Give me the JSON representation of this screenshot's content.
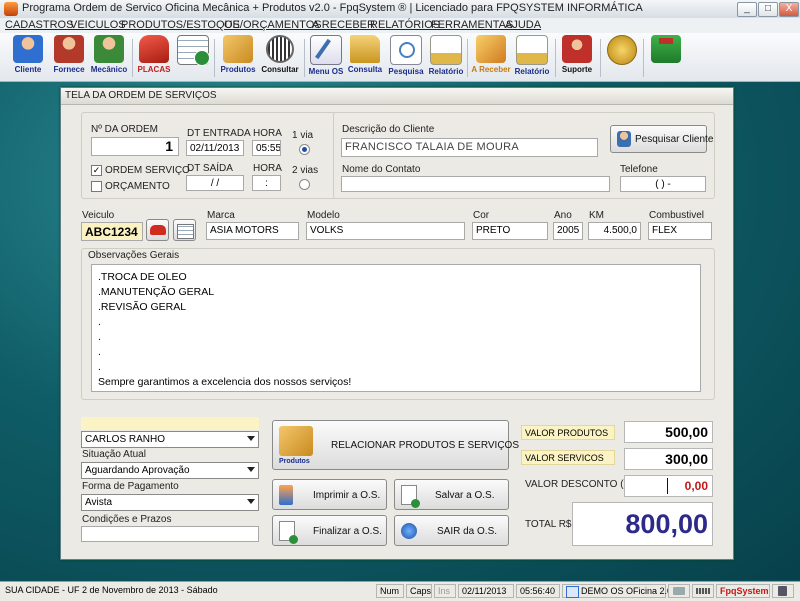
{
  "window": {
    "title": "Programa Ordem de Servico Oficina Mecânica + Produtos v2.0 - FpqSystem ® | Licenciado para FPQSYSTEM INFORMÁTICA",
    "buttons": [
      "_",
      "□",
      "X"
    ]
  },
  "menu": [
    "CADASTROS",
    "VEICULOS",
    "PRODUTOS/ESTOQUE",
    "OS/ORÇAMENTOS",
    "A RECEBER",
    "RELATÓRIOS",
    "FERRAMENTAS",
    "AJUDA"
  ],
  "toolbar": [
    {
      "label": "Cliente",
      "icon": "user-icon",
      "color": "#2f6fcf"
    },
    {
      "label": "Fornece",
      "icon": "supplier-icon",
      "color": "#b33a2b"
    },
    {
      "label": "Mecânico",
      "icon": "mechanic-icon",
      "color": "#3a8a3a"
    },
    {
      "label": "PLACAS",
      "icon": "car-icon",
      "color": "#d12b1e"
    },
    {
      "label": "",
      "icon": "calendar-clock-icon",
      "color": "#2b8f3a"
    },
    {
      "label": "Produtos",
      "icon": "boxes-icon",
      "color": "#d99a2b"
    },
    {
      "label": "Consultar",
      "icon": "barcode-icon",
      "color": "#555555"
    },
    {
      "label": "Menu OS",
      "icon": "edit-document-icon",
      "color": "#3a6fb0"
    },
    {
      "label": "Consulta",
      "icon": "folder-icon",
      "color": "#d9a93a"
    },
    {
      "label": "Pesquisa",
      "icon": "magnifier-icon",
      "color": "#6aa0d8"
    },
    {
      "label": "Relatório",
      "icon": "report-icon",
      "color": "#e0b84a"
    },
    {
      "label": "A Receber",
      "icon": "money-icon",
      "color": "#d98a2b"
    },
    {
      "label": "Relatório",
      "icon": "report-icon",
      "color": "#e0b84a"
    },
    {
      "label": "Suporte",
      "icon": "support-icon",
      "color": "#c0302a"
    },
    {
      "label": "",
      "icon": "coin-icon",
      "color": "#d9a12b"
    },
    {
      "label": "",
      "icon": "exit-icon",
      "color": "#3a9a3a"
    }
  ],
  "panel": {
    "title": "TELA DA ORDEM DE SERVIÇOS",
    "order": {
      "number_label": "Nº DA ORDEM",
      "number": "1",
      "dt_entrada_label": "DT ENTRADA",
      "dt_entrada": "02/11/2013",
      "hora_label": "HORA",
      "hora_entrada": "05:55",
      "via1_label": "1 via",
      "dt_saida_label": "DT SAÍDA",
      "dt_saida": " / / ",
      "hora_saida_label": "HORA",
      "hora_saida": ":",
      "via2_label": "2 vias",
      "os_servico_label": "ORDEM SERVIÇO",
      "orcamento_label": "ORÇAMENTO"
    },
    "client": {
      "desc_label": "Descrição do Cliente",
      "desc": "FRANCISCO TALAIA DE MOURA",
      "search_button": "Pesquisar Cliente",
      "contact_label": "Nome do Contato",
      "contact": "",
      "phone_label": "Telefone",
      "phone": "(   )     -"
    },
    "vehicle": {
      "veiculo_label": "Veiculo",
      "placa": "ABC1234",
      "marca_label": "Marca",
      "marca": "ASIA MOTORS",
      "modelo_label": "Modelo",
      "modelo": "VOLKS",
      "cor_label": "Cor",
      "cor": "PRETO",
      "ano_label": "Ano",
      "ano": "2005",
      "km_label": "KM",
      "km": "4.500,0",
      "combustivel_label": "Combustivel",
      "combustivel": "FLEX"
    },
    "notes": {
      "label": "Observações Gerais",
      "lines": [
        ".TROCA DE OLEO",
        ".MANUTENÇÃO GERAL",
        ".REVISÃO GERAL",
        ".",
        ".",
        ".",
        ".",
        "Sempre garantimos a excelencia dos nossos serviços!"
      ]
    },
    "bottom": {
      "mechanic": "CARLOS RANHO",
      "situacao_label": "Situação Atual",
      "situacao": "Aguardando Aprovação",
      "pagamento_label": "Forma de Pagamento",
      "pagamento": "Avista",
      "condicoes_label": "Condições e Prazos",
      "condicoes": "",
      "relacionar_button": "RELACIONAR PRODUTOS E SERVIÇOS",
      "relacionar_icon_label": "Produtos",
      "imprimir_button": "Imprimir a O.S.",
      "salvar_button": "Salvar a O.S.",
      "finalizar_button": "Finalizar a O.S.",
      "sair_button": "SAIR da O.S."
    },
    "totals": {
      "valor_produtos_label": "VALOR PRODUTOS",
      "valor_produtos": "500,00",
      "valor_servicos_label": "VALOR SERVICOS",
      "valor_servicos": "300,00",
      "valor_desconto_label": "VALOR DESCONTO ( - )",
      "valor_desconto": "0,00",
      "total_label": "TOTAL R$",
      "total": "800,00",
      "total_color": "#2d2a8a",
      "desconto_color": "#c01818"
    }
  },
  "statusbar": {
    "location": "SUA CIDADE - UF   2 de Novembro de 2013 - Sábado",
    "num": "Num",
    "caps": "Caps",
    "ins": "Ins",
    "date": "02/11/2013",
    "time": "05:56:40",
    "app": "DEMO OS OFicina 2.0",
    "brand": "FpqSystem"
  }
}
